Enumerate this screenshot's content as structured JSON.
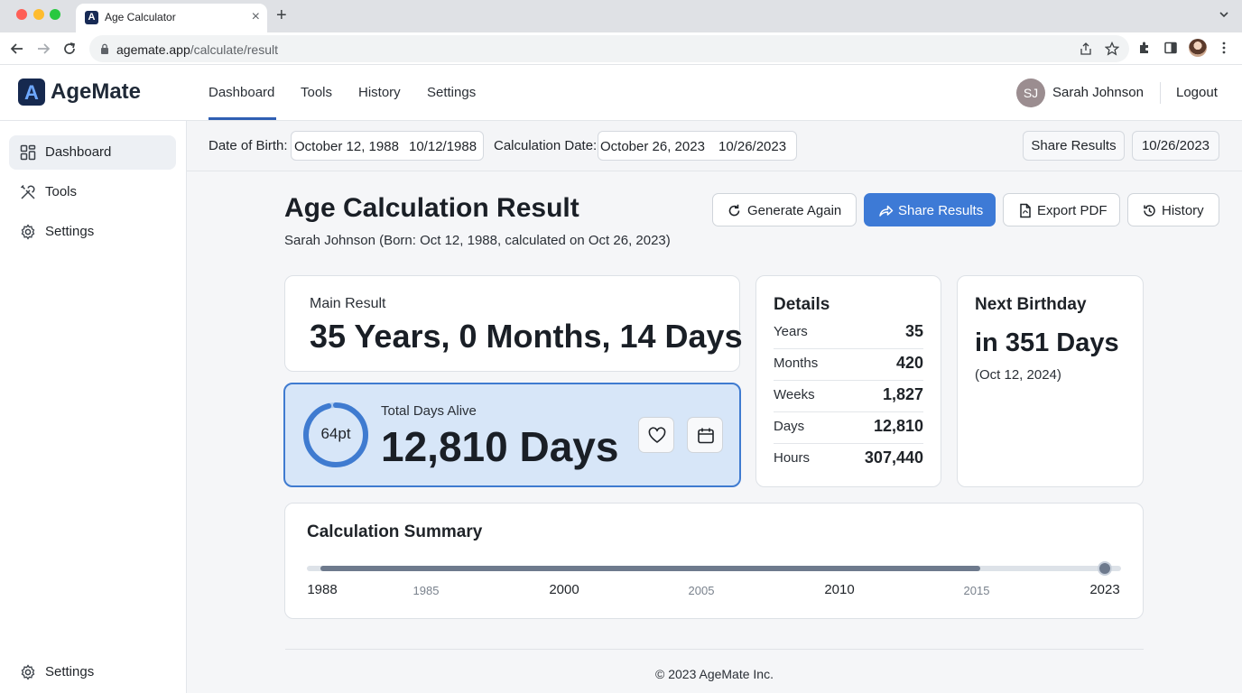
{
  "browser": {
    "tab_title": "Age Calculator",
    "tab_favicon": "A",
    "url_domain": "agemate.app",
    "url_path": "/calculate/result"
  },
  "app": {
    "logo_mark": "A",
    "logo_text": "AgeMate",
    "nav": [
      "Dashboard",
      "Tools",
      "History",
      "Settings"
    ],
    "active_nav": "Dashboard",
    "user": {
      "initials": "SJ",
      "name": "Sarah Johnson"
    },
    "logout_label": "Logout"
  },
  "sidebar": {
    "items": [
      {
        "label": "Dashboard",
        "icon": "grid-icon",
        "active": true
      },
      {
        "label": "Tools",
        "icon": "tools-icon",
        "active": false
      },
      {
        "label": "Settings",
        "icon": "gear-icon",
        "active": false
      }
    ],
    "bottom_item": {
      "label": "Settings",
      "icon": "gear-icon"
    }
  },
  "filters": {
    "dob_label": "Date of Birth:",
    "dob_long": "October 12, 1988",
    "dob_short": "10/12/1988",
    "calc_label": "Calculation Date:",
    "calc_long": "October 26, 2023",
    "calc_short": "10/26/2023",
    "share_label": "Share Results",
    "date_badge": "10/26/2023"
  },
  "result": {
    "title": "Age Calculation Result",
    "subtitle": "Sarah Johnson (Born: Oct 12, 1988, calculated on Oct 26, 2023)",
    "actions": {
      "generate": "Generate Again",
      "share": "Share Results",
      "export": "Export PDF",
      "history": "History"
    },
    "main_label": "Main Result",
    "main_value": "35 Years, 0 Months, 14 Days",
    "total_label": "Total Days Alive",
    "total_value": "12,810 Days",
    "ring_text": "64pt",
    "ring_progress": 0.96
  },
  "details": {
    "title": "Details",
    "rows": [
      {
        "label": "Years",
        "value": "35"
      },
      {
        "label": "Months",
        "value": "420"
      },
      {
        "label": "Weeks",
        "value": "1,827"
      },
      {
        "label": "Days",
        "value": "12,810"
      },
      {
        "label": "Hours",
        "value": "307,440"
      }
    ]
  },
  "next_birthday": {
    "title": "Next Birthday",
    "value": "in 351 Days",
    "date": "(Oct 12, 2024)"
  },
  "summary": {
    "title": "Calculation Summary",
    "progress": 0.81,
    "years": [
      {
        "label": "1988",
        "major": true
      },
      {
        "label": "1985",
        "major": false
      },
      {
        "label": "2000",
        "major": true
      },
      {
        "label": "2005",
        "major": false
      },
      {
        "label": "2010",
        "major": true
      },
      {
        "label": "2015",
        "major": false
      },
      {
        "label": "2023",
        "major": true
      }
    ]
  },
  "footer": {
    "text": "© 2023 AgeMate Inc."
  },
  "colors": {
    "accent": "#3d7ad6",
    "nav_active": "#2f5fb3",
    "logo_bg": "#16294f",
    "total_card_bg": "#d7e6f8",
    "slider": "#6e7a8d"
  }
}
